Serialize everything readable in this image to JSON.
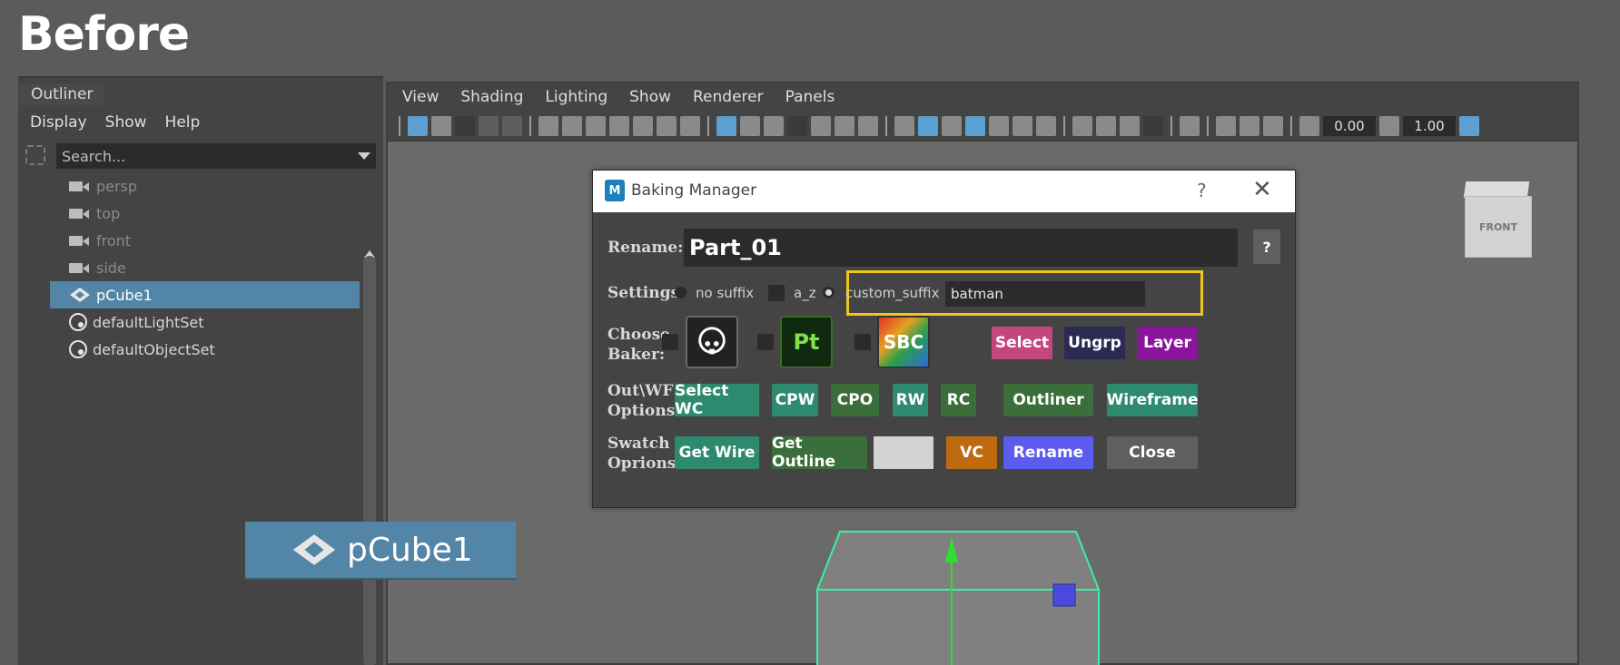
{
  "heading": "Before",
  "outliner": {
    "tab": "Outliner",
    "menu": [
      "Display",
      "Show",
      "Help"
    ],
    "search_placeholder": "Search...",
    "items": [
      {
        "label": "persp",
        "type": "camera"
      },
      {
        "label": "top",
        "type": "camera"
      },
      {
        "label": "front",
        "type": "camera"
      },
      {
        "label": "side",
        "type": "camera"
      },
      {
        "label": "pCube1",
        "type": "mesh",
        "selected": true
      },
      {
        "label": "defaultLightSet",
        "type": "set"
      },
      {
        "label": "defaultObjectSet",
        "type": "set"
      }
    ],
    "drag_label": "pCube1"
  },
  "viewport": {
    "menu": [
      "View",
      "Shading",
      "Lighting",
      "Show",
      "Renderer",
      "Panels"
    ],
    "field_a": "0.00",
    "field_b": "1.00",
    "viewcube_label": "FRONT"
  },
  "dialog": {
    "title": "Baking Manager",
    "help_glyph": "?",
    "close_glyph": "✕",
    "app_icon": "M",
    "rename_label": "Rename:",
    "rename_value": "Part_01",
    "help_button": "?",
    "settings_label": "Settings:",
    "opt_no_suffix": "no suffix",
    "opt_az": "a_z",
    "opt_custom": "custom_suffix",
    "custom_value": "batman",
    "choose_label_1": "Choose",
    "choose_label_2": "Baker:",
    "baker_pt": "Pt",
    "baker_sbc": "SBC",
    "btn_select": "Select",
    "btn_ungrp": "Ungrp",
    "btn_layer": "Layer",
    "out_label_1": "Out\\WF",
    "out_label_2": "Options:",
    "btn_select_wc": "Select WC",
    "btn_cpw": "CPW",
    "btn_cpo": "CPO",
    "btn_rw": "RW",
    "btn_rc": "RC",
    "btn_outliner": "Outliner",
    "btn_wireframe": "Wireframe",
    "swatch_label_1": "Swatch",
    "swatch_label_2": "Oprions:",
    "btn_get_wire": "Get Wire",
    "btn_get_outline": "Get Outline",
    "btn_vc": "VC",
    "btn_rename": "Rename",
    "btn_close": "Close"
  },
  "colors": {
    "teal": "#2e8a6e",
    "green": "#3a6e3a",
    "pink": "#c4467e",
    "navy": "#2a2a55",
    "purple": "#8a159c",
    "orange": "#c06a10",
    "blue": "#5b5bf0",
    "grey": "#5f5f5f",
    "highlight": "#f2c618",
    "selection": "#5285a6"
  }
}
